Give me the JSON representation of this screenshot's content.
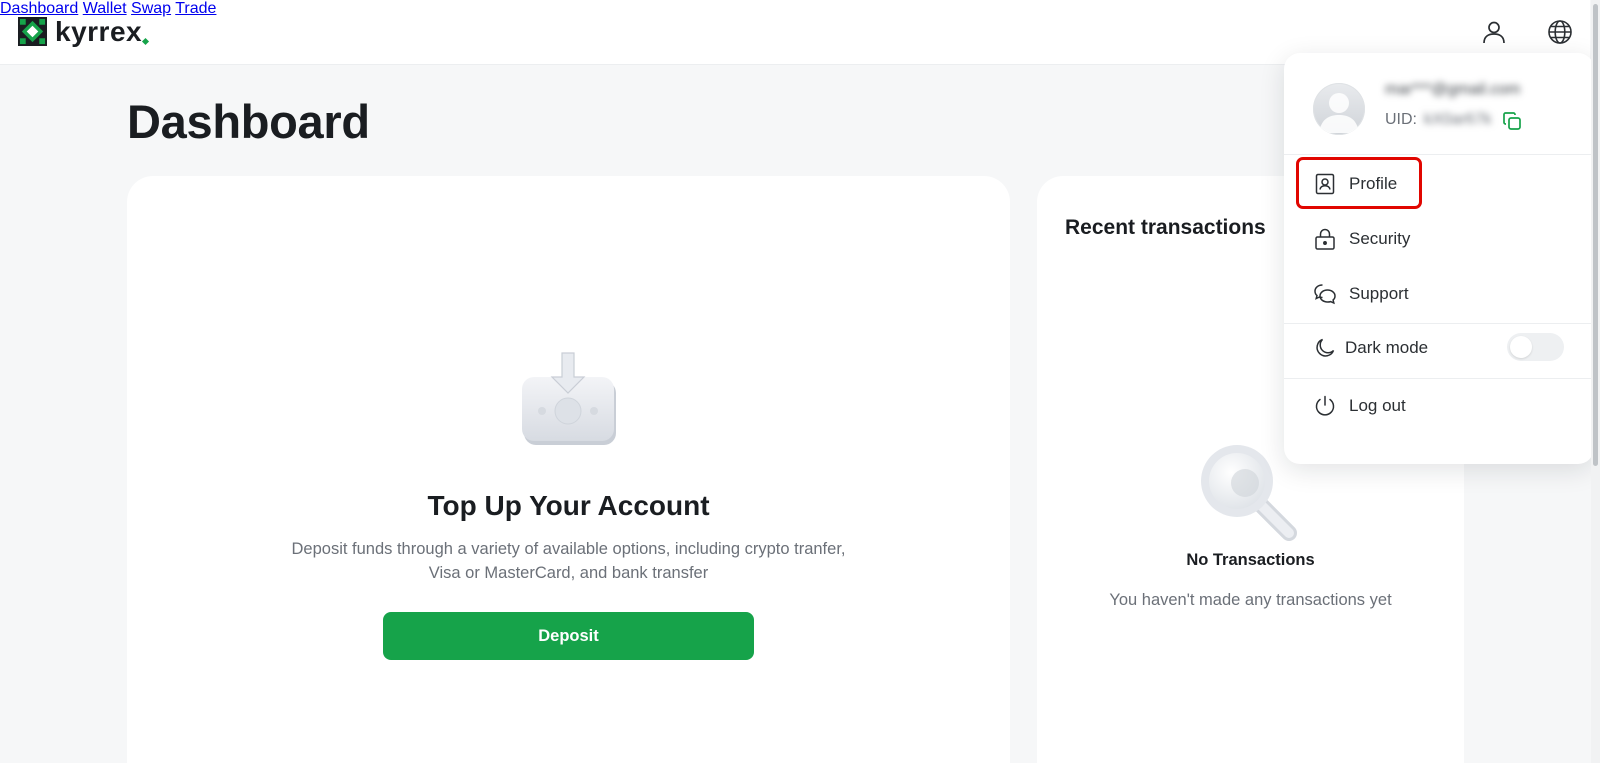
{
  "brand": {
    "name": "kyrrex",
    "accent": "#16a34a"
  },
  "nav": {
    "items": [
      {
        "label": "Dashboard"
      },
      {
        "label": "Wallet"
      },
      {
        "label": "Swap"
      },
      {
        "label": "Trade"
      }
    ],
    "icons": [
      "user-icon",
      "globe-icon"
    ]
  },
  "page": {
    "title": "Dashboard"
  },
  "topup": {
    "title": "Top Up Your Account",
    "description_line1": "Deposit funds through a variety of available options, including crypto tranfer,",
    "description_line2": "Visa or MasterCard, and bank transfer",
    "button_label": "Deposit"
  },
  "transactions": {
    "title": "Recent transactions",
    "empty_title": "No Transactions",
    "empty_desc": "You haven't made any transactions yet"
  },
  "user_menu": {
    "email": "mar***@gmail.com",
    "uid_label": "UID:",
    "uid_value": "kX0ar67k",
    "items": [
      {
        "label": "Profile",
        "icon": "id-card-icon"
      },
      {
        "label": "Security",
        "icon": "lock-icon"
      },
      {
        "label": "Support",
        "icon": "chat-bubbles-icon"
      },
      {
        "label": "Dark mode",
        "icon": "moon-icon"
      },
      {
        "label": "Log out",
        "icon": "power-icon"
      }
    ],
    "dark_mode_enabled": false,
    "highlight_color": "#e10600"
  }
}
